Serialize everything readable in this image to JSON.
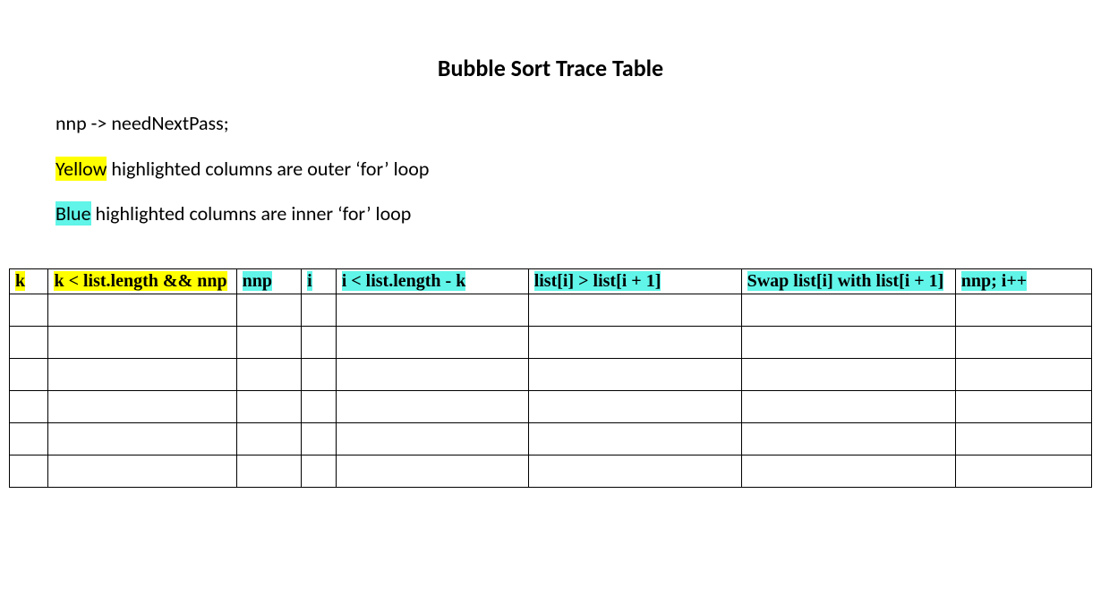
{
  "title": "Bubble Sort Trace Table",
  "notes": {
    "line1": "nnp -> needNextPass;",
    "line2": {
      "hl": "Yellow",
      "rest": " highlighted columns are outer ‘for’ loop"
    },
    "line3": {
      "hl": "Blue",
      "rest": " highlighted columns are inner ‘for’ loop"
    }
  },
  "headers": {
    "c0": "k",
    "c1": "k < list.length && nnp",
    "c2": "nnp",
    "c3": "i",
    "c4": "i < list.length - k",
    "c5": "list[i] > list[i + 1]",
    "c6": "Swap list[i] with list[i + 1]",
    "c7": "nnp; i++"
  },
  "empty_row_count": 6
}
